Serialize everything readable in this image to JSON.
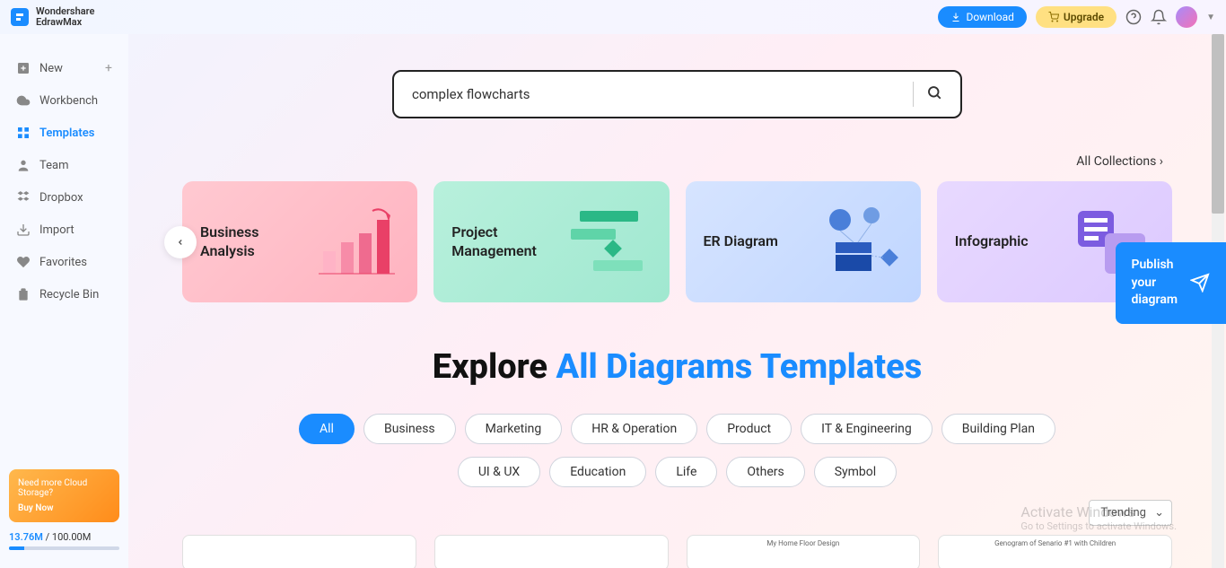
{
  "header": {
    "brand_line1": "Wondershare",
    "brand_line2": "EdrawMax",
    "download": "Download",
    "upgrade": "Upgrade"
  },
  "sidebar": {
    "items": [
      {
        "label": "New",
        "icon": "plus-square"
      },
      {
        "label": "Workbench",
        "icon": "cloud"
      },
      {
        "label": "Templates",
        "icon": "template"
      },
      {
        "label": "Team",
        "icon": "user"
      },
      {
        "label": "Dropbox",
        "icon": "dropbox"
      },
      {
        "label": "Import",
        "icon": "import"
      },
      {
        "label": "Favorites",
        "icon": "heart"
      },
      {
        "label": "Recycle Bin",
        "icon": "trash"
      }
    ],
    "storage_promo_line1": "Need more Cloud",
    "storage_promo_line2": "Storage?",
    "storage_promo_cta": "Buy Now",
    "storage_used": "13.76M",
    "storage_sep": " / ",
    "storage_total": "100.00M"
  },
  "search": {
    "value": "complex flowcharts"
  },
  "all_collections": "All Collections",
  "categories": [
    {
      "title": "Business Analysis"
    },
    {
      "title": "Project Management"
    },
    {
      "title": "ER Diagram"
    },
    {
      "title": "Infographic"
    }
  ],
  "explore": {
    "prefix": "Explore ",
    "highlight": "All Diagrams Templates"
  },
  "filters": [
    "All",
    "Business",
    "Marketing",
    "HR & Operation",
    "Product",
    "IT & Engineering",
    "Building Plan",
    "UI & UX",
    "Education",
    "Life",
    "Others",
    "Symbol"
  ],
  "sort": "Trending",
  "templates": [
    {
      "caption": ""
    },
    {
      "caption": ""
    },
    {
      "caption": "My Home Floor Design"
    },
    {
      "caption": "Genogram of Senario #1 with Children"
    }
  ],
  "publish": {
    "line1": "Publish",
    "line2": "your",
    "line3": "diagram"
  },
  "watermark": {
    "title": "Activate Windows",
    "sub": "Go to Settings to activate Windows."
  }
}
